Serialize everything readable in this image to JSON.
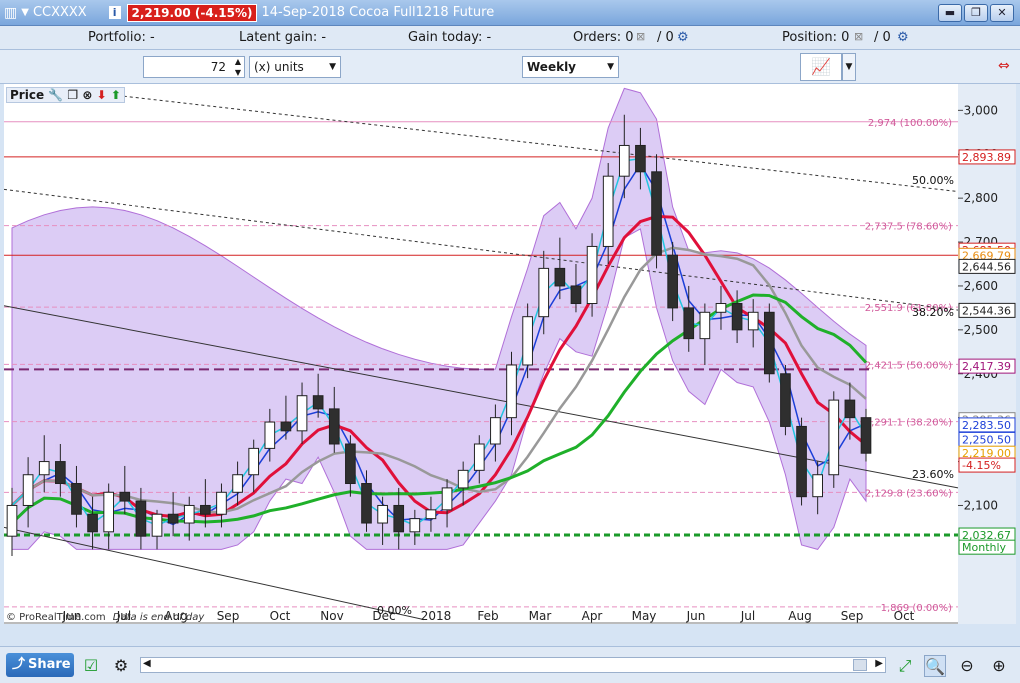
{
  "window": {
    "ticker": "CCXXXX",
    "price_badge": "2,219.00 (-4.15%)",
    "title": "14-Sep-2018 Cocoa Full1218 Future"
  },
  "info": {
    "portfolio": "Portfolio: -",
    "latent": "Latent gain: -",
    "gain_today": "Gain today: -",
    "orders": "Orders: 0",
    "orders_b": "/ 0",
    "position": "Position: 0",
    "position_b": "/ 0"
  },
  "toolbar": {
    "bars": "72",
    "units": "(x) units",
    "period": "Weekly"
  },
  "panel": {
    "label": "Price",
    "credit": "© ProRealTime.com",
    "note": "Data is end of day"
  },
  "colors": {
    "candle_up": "#ffffff",
    "candle_down": "#2f2f2f",
    "resistance": "#d42020",
    "cloud": "#b28ee8",
    "price_badge": "#d8201b"
  },
  "chart_data": {
    "type": "candlestick",
    "x_ticks": [
      "Jun",
      "Jul",
      "Aug",
      "Sep",
      "Oct",
      "Nov",
      "Dec",
      "2018",
      "Feb",
      "Mar",
      "Apr",
      "May",
      "Jun",
      "Jul",
      "Aug",
      "Sep",
      "Oct"
    ],
    "y_ticks": [
      2100,
      2200,
      2300,
      2400,
      2500,
      2600,
      2700,
      2800,
      2900,
      3000
    ],
    "ylim": [
      1830,
      3060
    ],
    "fib_levels": [
      {
        "label": "2,974 (100.00%)",
        "value": 2974
      },
      {
        "label": "2,737.5 (78.60%)",
        "value": 2737.5
      },
      {
        "label": "2,551.9 (61.80%)",
        "value": 2551.9
      },
      {
        "label": "2,421.5 (50.00%)",
        "value": 2421.5
      },
      {
        "label": "2,291.1 (38.20%)",
        "value": 2291.1
      },
      {
        "label": "2,129.8 (23.60%)",
        "value": 2129.8
      },
      {
        "label": "1,869 (0.00%)",
        "value": 1869
      }
    ],
    "trend_labels": [
      "50.00%",
      "38.20%",
      "23.60%",
      "0.00%"
    ],
    "price_tags": [
      {
        "text": "2,893.89",
        "value": 2893.89,
        "color": "#d42020"
      },
      {
        "text": "2,681.50",
        "value": 2681.5,
        "color": "#d42020"
      },
      {
        "text": "2,669.79",
        "value": 2669.79,
        "color": "#e88c10"
      },
      {
        "text": "2,644.56",
        "value": 2644.56,
        "color": "#222222"
      },
      {
        "text": "2,544.36",
        "value": 2544.36,
        "color": "#222222"
      },
      {
        "text": "2,417.39",
        "value": 2417.39,
        "color": "#a0157a"
      },
      {
        "text": "2,295.36",
        "value": 2295.36,
        "color": "#888888"
      },
      {
        "text": "2,283.50",
        "value": 2283.5,
        "color": "#1c3fd8"
      },
      {
        "text": "2,250.50",
        "value": 2250.5,
        "color": "#1c3fd8"
      },
      {
        "text": "2,219.00",
        "value": 2219,
        "color": "#e8a000"
      },
      {
        "text": "-4.15%",
        "value": 2192,
        "color": "#d42020"
      },
      {
        "text": "2,032.67",
        "value": 2032.67,
        "color": "#1b9a2a"
      },
      {
        "text": "Monthly",
        "value": 2005,
        "color": "#1b9a2a"
      }
    ],
    "candles": [
      [
        2030,
        2140,
        1985,
        2100
      ],
      [
        2100,
        2210,
        2050,
        2170
      ],
      [
        2170,
        2260,
        2130,
        2200
      ],
      [
        2200,
        2240,
        2120,
        2150
      ],
      [
        2150,
        2190,
        2050,
        2080
      ],
      [
        2080,
        2120,
        2000,
        2040
      ],
      [
        2040,
        2150,
        2000,
        2130
      ],
      [
        2130,
        2190,
        2080,
        2110
      ],
      [
        2110,
        2140,
        2000,
        2030
      ],
      [
        2030,
        2090,
        2000,
        2080
      ],
      [
        2080,
        2130,
        2030,
        2060
      ],
      [
        2060,
        2120,
        2020,
        2100
      ],
      [
        2100,
        2160,
        2050,
        2080
      ],
      [
        2080,
        2150,
        2050,
        2130
      ],
      [
        2130,
        2200,
        2100,
        2170
      ],
      [
        2170,
        2250,
        2130,
        2230
      ],
      [
        2230,
        2320,
        2200,
        2290
      ],
      [
        2290,
        2350,
        2250,
        2270
      ],
      [
        2270,
        2380,
        2240,
        2350
      ],
      [
        2350,
        2400,
        2300,
        2320
      ],
      [
        2320,
        2370,
        2220,
        2240
      ],
      [
        2240,
        2260,
        2120,
        2150
      ],
      [
        2150,
        2180,
        2040,
        2060
      ],
      [
        2060,
        2120,
        2010,
        2100
      ],
      [
        2100,
        2140,
        2000,
        2040
      ],
      [
        2040,
        2090,
        2010,
        2070
      ],
      [
        2070,
        2120,
        2040,
        2090
      ],
      [
        2090,
        2160,
        2050,
        2140
      ],
      [
        2140,
        2200,
        2100,
        2180
      ],
      [
        2180,
        2260,
        2150,
        2240
      ],
      [
        2240,
        2330,
        2200,
        2300
      ],
      [
        2300,
        2450,
        2260,
        2420
      ],
      [
        2420,
        2560,
        2390,
        2530
      ],
      [
        2530,
        2680,
        2490,
        2640
      ],
      [
        2640,
        2710,
        2570,
        2600
      ],
      [
        2600,
        2650,
        2540,
        2560
      ],
      [
        2560,
        2720,
        2530,
        2690
      ],
      [
        2690,
        2880,
        2650,
        2850
      ],
      [
        2850,
        2990,
        2800,
        2920
      ],
      [
        2920,
        2960,
        2820,
        2860
      ],
      [
        2860,
        2900,
        2640,
        2670
      ],
      [
        2670,
        2700,
        2520,
        2550
      ],
      [
        2550,
        2600,
        2450,
        2480
      ],
      [
        2480,
        2560,
        2420,
        2540
      ],
      [
        2540,
        2600,
        2500,
        2560
      ],
      [
        2560,
        2590,
        2470,
        2500
      ],
      [
        2500,
        2570,
        2460,
        2540
      ],
      [
        2540,
        2560,
        2380,
        2400
      ],
      [
        2400,
        2420,
        2260,
        2280
      ],
      [
        2280,
        2300,
        2100,
        2120
      ],
      [
        2120,
        2200,
        2080,
        2170
      ],
      [
        2170,
        2360,
        2140,
        2340
      ],
      [
        2340,
        2380,
        2250,
        2300
      ],
      [
        2300,
        2320,
        2200,
        2219
      ]
    ]
  }
}
